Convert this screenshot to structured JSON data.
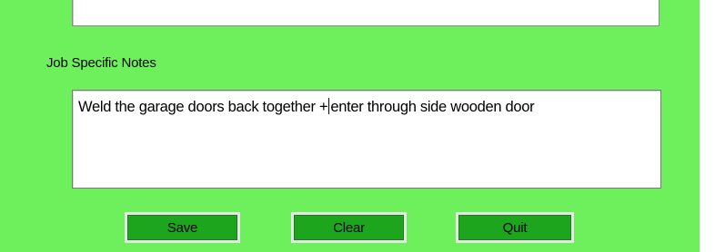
{
  "form": {
    "top_field_value": "",
    "notes_label": "Job Specific Notes",
    "notes_text_before_caret": "Weld the garage doors back together +",
    "notes_text_after_caret": "enter through side wooden door"
  },
  "buttons": {
    "save_label": "Save",
    "clear_label": "Clear",
    "quit_label": "Quit"
  },
  "colors": {
    "panel_background": "#6ef05c",
    "button_background": "#1ea51e",
    "button_border": "#e6e6e6"
  }
}
